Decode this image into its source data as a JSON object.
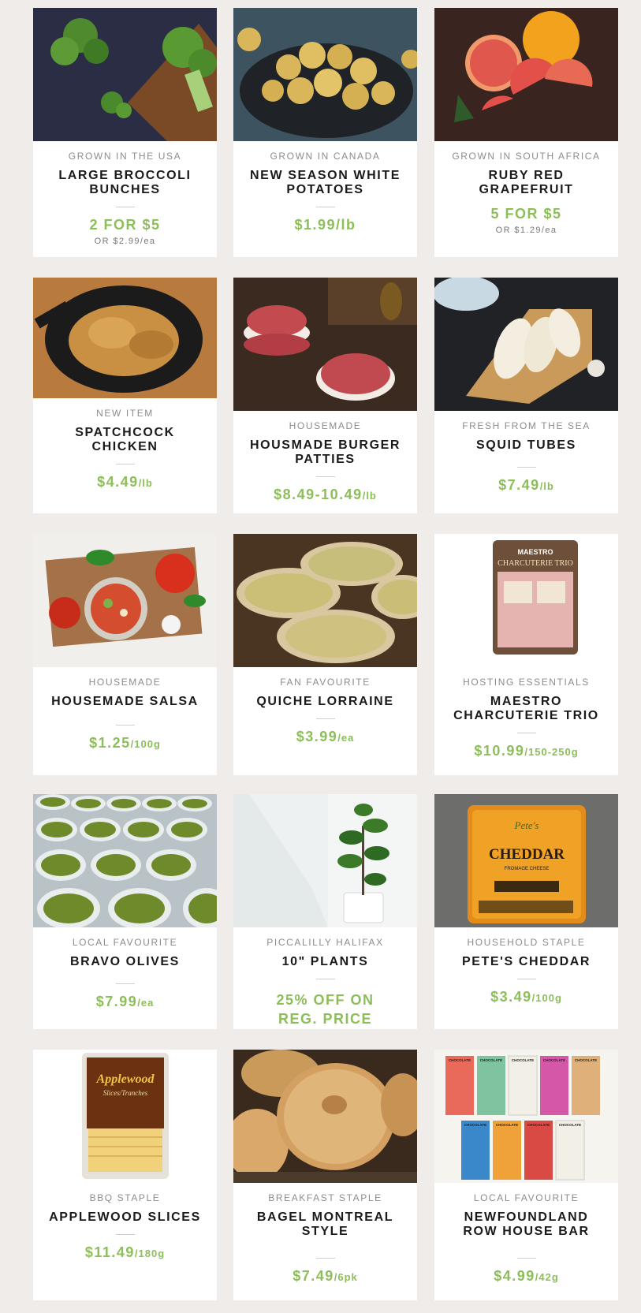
{
  "products": [
    {
      "tag": "GROWN IN THE USA",
      "name": "LARGE BROCCOLI BUNCHES",
      "price": "2 FOR $5",
      "unit": "",
      "sub": "OR $2.99/ea"
    },
    {
      "tag": "GROWN IN CANADA",
      "name": "NEW SEASON WHITE POTATOES",
      "price": "$1.99/lb",
      "unit": "",
      "sub": ""
    },
    {
      "tag": "GROWN IN SOUTH AFRICA",
      "name": "RUBY RED GRAPEFRUIT",
      "price": "5 FOR $5",
      "unit": "",
      "sub": "OR $1.29/ea"
    },
    {
      "tag": "NEW ITEM",
      "name": "SPATCHCOCK CHICKEN",
      "price": "$4.49",
      "unit": "/lb",
      "sub": ""
    },
    {
      "tag": "HOUSEMADE",
      "name": "HOUSMADE BURGER PATTIES",
      "price": "$8.49-10.49",
      "unit": "/lb",
      "sub": ""
    },
    {
      "tag": "FRESH FROM THE SEA",
      "name": "SQUID TUBES",
      "price": "$7.49",
      "unit": "/lb",
      "sub": ""
    },
    {
      "tag": "HOUSEMADE",
      "name": "HOUSEMADE SALSA",
      "price": "$1.25",
      "unit": "/100g",
      "sub": ""
    },
    {
      "tag": "FAN FAVOURITE",
      "name": "QUICHE LORRAINE",
      "price": "$3.99",
      "unit": "/ea",
      "sub": ""
    },
    {
      "tag": "HOSTING ESSENTIALS",
      "name": "MAESTRO CHARCUTERIE TRIO",
      "price": "$10.99",
      "unit": "/150-250g",
      "sub": ""
    },
    {
      "tag": "LOCAL FAVOURITE",
      "name": "BRAVO OLIVES",
      "price": "$7.99",
      "unit": "/ea",
      "sub": ""
    },
    {
      "tag": "PICCALILLY HALIFAX",
      "name": "10\" PLANTS",
      "price": "25% OFF ON REG. PRICE",
      "unit": "",
      "sub": ""
    },
    {
      "tag": "HOUSEHOLD STAPLE",
      "name": "PETE'S CHEDDAR",
      "price": "$3.49",
      "unit": "/100g",
      "sub": ""
    },
    {
      "tag": "BBQ STAPLE",
      "name": "APPLEWOOD SLICES",
      "price": "$11.49",
      "unit": "/180g",
      "sub": ""
    },
    {
      "tag": "BREAKFAST STAPLE",
      "name": "BAGEL MONTREAL STYLE",
      "price": "$7.49",
      "unit": "/6pk",
      "sub": ""
    },
    {
      "tag": "LOCAL FAVOURITE",
      "name": "NEWFOUNDLAND ROW HOUSE BAR",
      "price": "$4.99",
      "unit": "/42g",
      "sub": ""
    }
  ],
  "packaging": {
    "charcuterie_brand": "MAESTRO",
    "charcuterie_title": "CHARCUTERIE TRIO",
    "cheddar_brand": "Pete's",
    "cheddar_title": "CHEDDAR",
    "cheddar_subtitle": "FROMAGE CHEESE",
    "applewood_title": "Applewood",
    "applewood_subtitle": "Slices/Tranches",
    "chocolate_label": "CHOCOLATE"
  }
}
